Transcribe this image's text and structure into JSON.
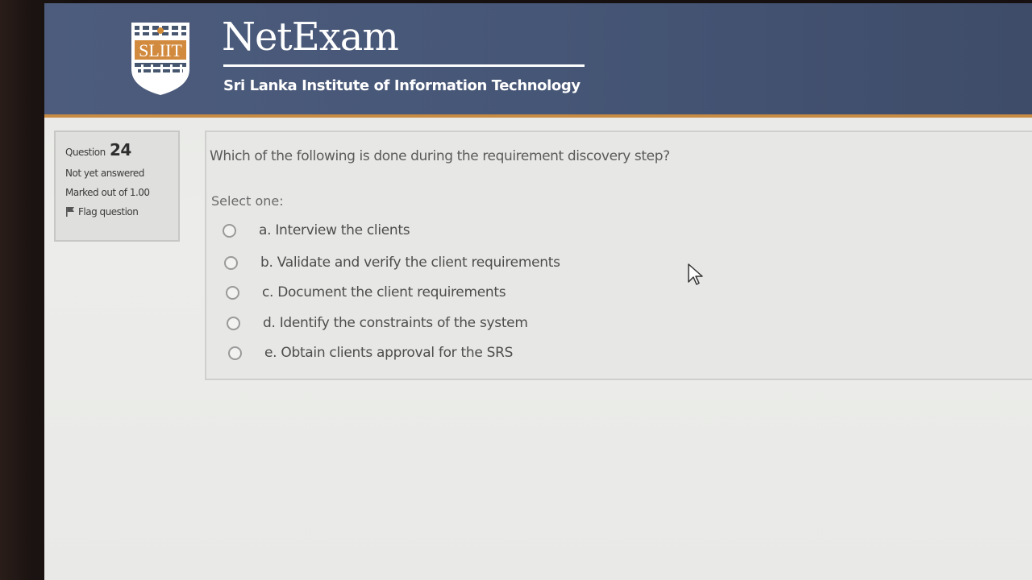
{
  "header": {
    "logo_text": "SLIIT",
    "app_title": "NetExam",
    "institution": "Sri Lanka Institute of Information Technology"
  },
  "question_info": {
    "label": "Question",
    "number": "24",
    "status": "Not yet answered",
    "marks": "Marked out of 1.00",
    "flag_label": "Flag question"
  },
  "question": {
    "text": "Which of the following is done during the requirement discovery step?",
    "prompt": "Select one:",
    "options": [
      {
        "label": "a. Interview the clients",
        "selected": false
      },
      {
        "label": "b. Validate and verify the client requirements",
        "selected": false
      },
      {
        "label": "c. Document the client requirements",
        "selected": false
      },
      {
        "label": "d. Identify the constraints of the system",
        "selected": false
      },
      {
        "label": "e. Obtain clients approval for the  SRS",
        "selected": false
      }
    ]
  },
  "colors": {
    "header_bg": "#465676",
    "header_accent": "#c88b43",
    "page_bg": "#e8e9e6"
  },
  "icons": {
    "logo": "sliit-shield-icon",
    "flag": "flag-icon",
    "cursor": "mouse-pointer-icon"
  }
}
